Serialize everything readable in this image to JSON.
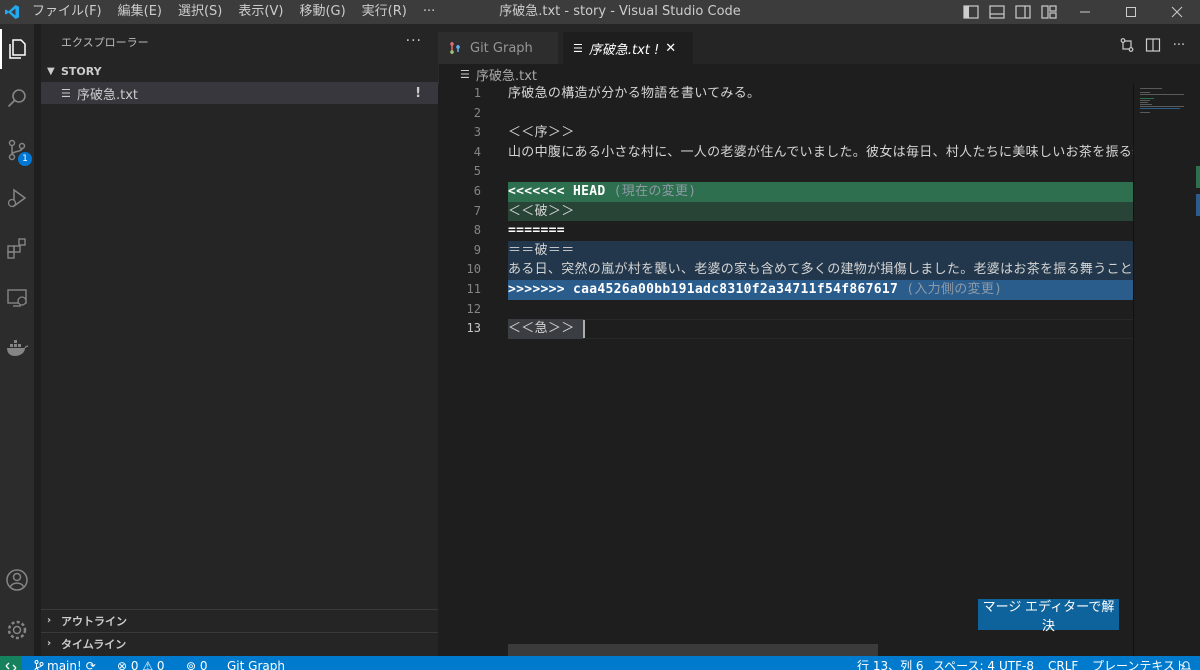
{
  "titlebar": {
    "menu": [
      "ファイル(F)",
      "編集(E)",
      "選択(S)",
      "表示(V)",
      "移動(G)",
      "実行(R)",
      "···"
    ],
    "title": "序破急.txt - story - Visual Studio Code"
  },
  "activity": {
    "scm_badge": "1"
  },
  "sidebar": {
    "header": "エクスプローラー",
    "more": "···",
    "folder": "STORY",
    "file": "序破急.txt",
    "file_status": "!",
    "outline": "アウトライン",
    "timeline": "タイムライン"
  },
  "tabs": {
    "inactive_label": "Git Graph",
    "active_label": "序破急.txt !",
    "close": "✕"
  },
  "breadcrumb": {
    "file": "序破急.txt"
  },
  "editor": {
    "lines": [
      {
        "n": "1",
        "text": "序破急の構造が分かる物語を書いてみる。"
      },
      {
        "n": "2",
        "text": ""
      },
      {
        "n": "3",
        "text": "＜＜序＞＞"
      },
      {
        "n": "4",
        "text": "山の中腹にある小さな村に、一人の老婆が住んでいました。彼女は毎日、村人たちに美味しいお茶を振る舞っていました。"
      },
      {
        "n": "5",
        "text": ""
      },
      {
        "n": "6",
        "text": "<<<<<<< HEAD",
        "hint": " (現在の変更)"
      },
      {
        "n": "7",
        "text": "＜＜破＞＞"
      },
      {
        "n": "8",
        "text": "======="
      },
      {
        "n": "9",
        "text": "＝＝破＝＝"
      },
      {
        "n": "10",
        "text": "ある日、突然の嵐が村を襲い、老婆の家も含めて多くの建物が損傷しました。老婆はお茶を振る舞うことができなくなりました。"
      },
      {
        "n": "11",
        "text": ">>>>>>> caa4526a00bb191adc8310f2a34711f54f867617",
        "hint": " (入力側の変更)"
      },
      {
        "n": "12",
        "text": ""
      },
      {
        "n": "13",
        "text": "＜＜急＞＞"
      }
    ],
    "merge_button": "マージ エディターで解決"
  },
  "statusbar": {
    "branch": "main!",
    "problems": "⊗ 0 ⚠ 0",
    "ports": "0",
    "git_graph": "Git Graph",
    "position": "行 13、列 6",
    "spaces": "スペース: 4",
    "encoding": "UTF-8",
    "eol": "CRLF",
    "language": "プレーンテキスト"
  },
  "colors": {
    "accent": "#007acc",
    "current_change": "#2d6f4e",
    "incoming_change": "#2a5c8c"
  }
}
